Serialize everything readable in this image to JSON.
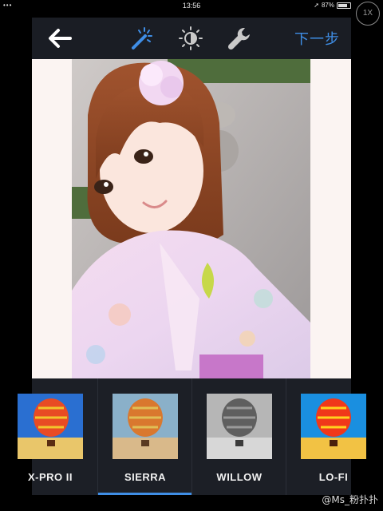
{
  "status_bar": {
    "signal": "••• ",
    "time": "13:56",
    "battery_percent": "87%"
  },
  "zoom_badge": "1X",
  "toolbar": {
    "next_label": "下一步"
  },
  "filters": [
    {
      "label": "X-PRO II",
      "selected": false
    },
    {
      "label": "SIERRA",
      "selected": true
    },
    {
      "label": "WILLOW",
      "selected": false
    },
    {
      "label": "LO-FI",
      "selected": false
    }
  ],
  "watermark": "@Ms_粉扑扑",
  "colors": {
    "accent": "#3f8ee6",
    "toolbar_bg": "#1a1d24",
    "strip_bg": "#1c1f26"
  }
}
